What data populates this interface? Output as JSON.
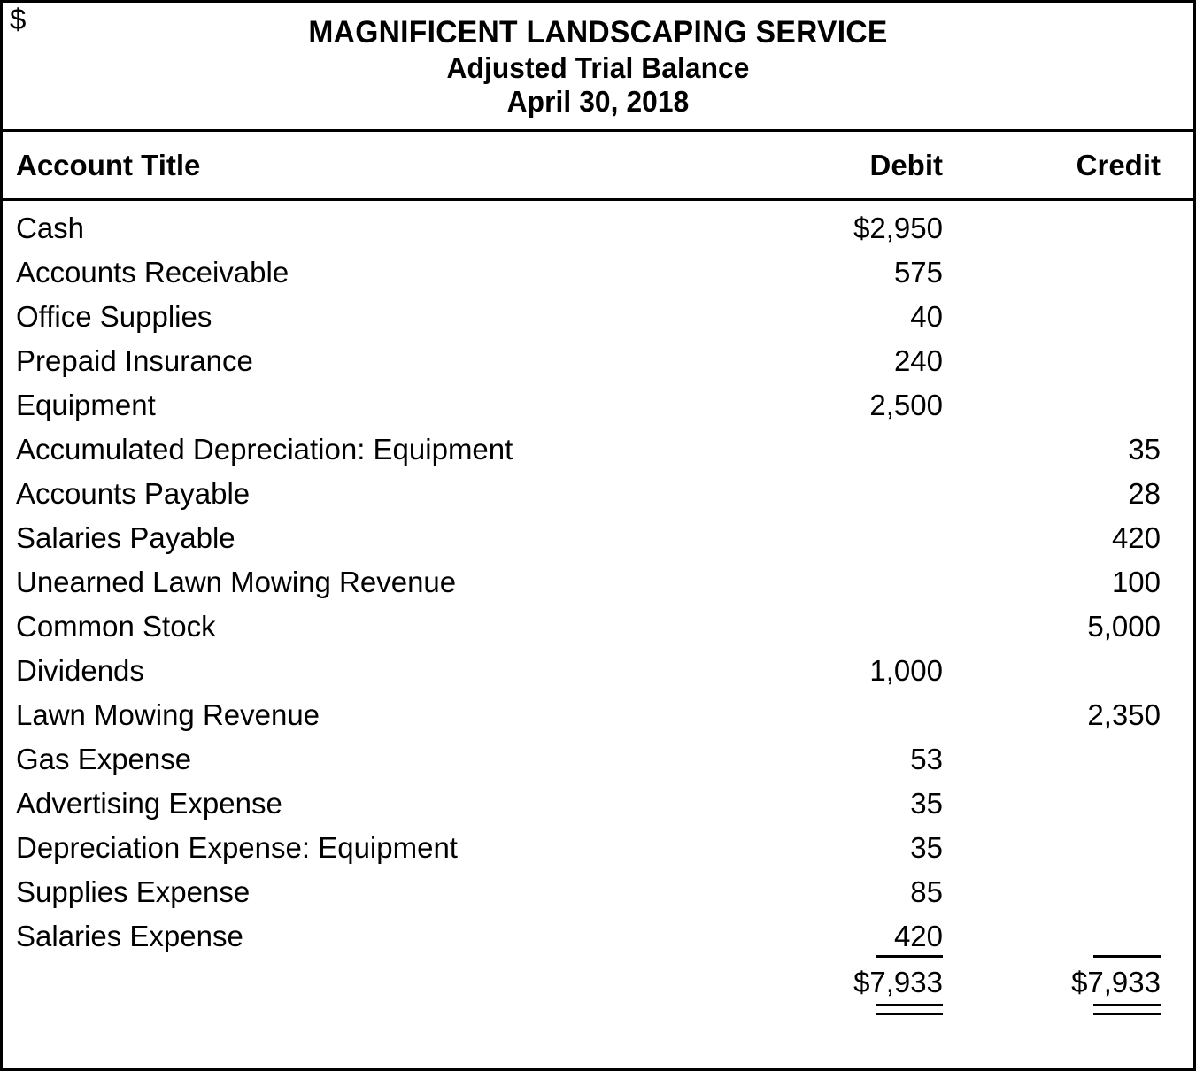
{
  "document": {
    "company": "MAGNIFICENT LANDSCAPING SERVICE",
    "statement": "Adjusted Trial Balance",
    "date": "April 30, 2018"
  },
  "columns": {
    "account_title": "Account Title",
    "debit": "Debit",
    "credit": "Credit"
  },
  "rows": [
    {
      "account": "Cash",
      "debit": "$2,950",
      "debit_currency": "",
      "credit": "",
      "credit_currency": ""
    },
    {
      "account": "Accounts Receivable",
      "debit": "575",
      "debit_currency": "",
      "credit": "",
      "credit_currency": ""
    },
    {
      "account": "Office Supplies",
      "debit": "40",
      "debit_currency": "",
      "credit": "",
      "credit_currency": ""
    },
    {
      "account": "Prepaid Insurance",
      "debit": "240",
      "debit_currency": "",
      "credit": "",
      "credit_currency": ""
    },
    {
      "account": "Equipment",
      "debit": "2,500",
      "debit_currency": "",
      "credit": "",
      "credit_currency": ""
    },
    {
      "account": "Accumulated Depreciation: Equipment",
      "debit": "",
      "debit_currency": "",
      "credit": "35",
      "credit_currency": "$"
    },
    {
      "account": "Accounts Payable",
      "debit": "",
      "debit_currency": "",
      "credit": "28",
      "credit_currency": ""
    },
    {
      "account": "Salaries Payable",
      "debit": "",
      "debit_currency": "",
      "credit": "420",
      "credit_currency": ""
    },
    {
      "account": "Unearned Lawn Mowing Revenue",
      "debit": "",
      "debit_currency": "",
      "credit": "100",
      "credit_currency": ""
    },
    {
      "account": "Common Stock",
      "debit": "",
      "debit_currency": "",
      "credit": "5,000",
      "credit_currency": ""
    },
    {
      "account": "Dividends",
      "debit": "1,000",
      "debit_currency": "",
      "credit": "",
      "credit_currency": ""
    },
    {
      "account": "Lawn Mowing Revenue",
      "debit": "",
      "debit_currency": "",
      "credit": "2,350",
      "credit_currency": ""
    },
    {
      "account": "Gas Expense",
      "debit": "53",
      "debit_currency": "",
      "credit": "",
      "credit_currency": ""
    },
    {
      "account": "Advertising Expense",
      "debit": "35",
      "debit_currency": "",
      "credit": "",
      "credit_currency": ""
    },
    {
      "account": "Depreciation Expense: Equipment",
      "debit": "35",
      "debit_currency": "",
      "credit": "",
      "credit_currency": ""
    },
    {
      "account": "Supplies Expense",
      "debit": "85",
      "debit_currency": "",
      "credit": "",
      "credit_currency": ""
    },
    {
      "account": "Salaries Expense",
      "debit": "420",
      "debit_currency": "",
      "credit": "",
      "credit_currency": ""
    }
  ],
  "totals": {
    "label": "",
    "debit": "$7,933",
    "credit": "$7,933"
  }
}
